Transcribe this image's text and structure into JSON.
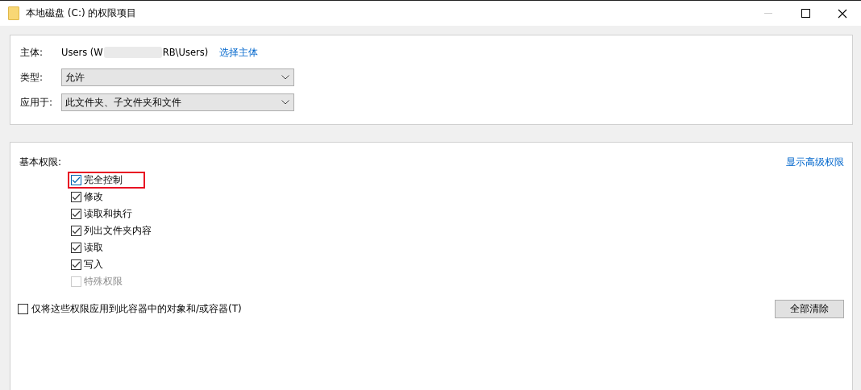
{
  "window": {
    "title": "本地磁盘 (C:) 的权限项目"
  },
  "principal": {
    "label": "主体:",
    "value_start": "Users (W",
    "value_end": "RB\\Users)",
    "redacted": true,
    "link": "选择主体"
  },
  "fields": [
    {
      "label": "类型:",
      "value": "允许"
    },
    {
      "label": "应用于:",
      "value": "此文件夹、子文件夹和文件"
    }
  ],
  "permissions": {
    "label": "基本权限:",
    "advanced_link": "显示高级权限",
    "items": [
      {
        "label": "完全控制",
        "checked": true,
        "disabled": false,
        "highlighted": true
      },
      {
        "label": "修改",
        "checked": true,
        "disabled": false,
        "highlighted": false
      },
      {
        "label": "读取和执行",
        "checked": true,
        "disabled": false,
        "highlighted": false
      },
      {
        "label": "列出文件夹内容",
        "checked": true,
        "disabled": false,
        "highlighted": false
      },
      {
        "label": "读取",
        "checked": true,
        "disabled": false,
        "highlighted": false
      },
      {
        "label": "写入",
        "checked": true,
        "disabled": false,
        "highlighted": false
      },
      {
        "label": "特殊权限",
        "checked": false,
        "disabled": true,
        "highlighted": false
      }
    ]
  },
  "apply_only": {
    "label": "仅将这些权限应用到此容器中的对象和/或容器(T)",
    "checked": false
  },
  "clear_button": "全部清除"
}
